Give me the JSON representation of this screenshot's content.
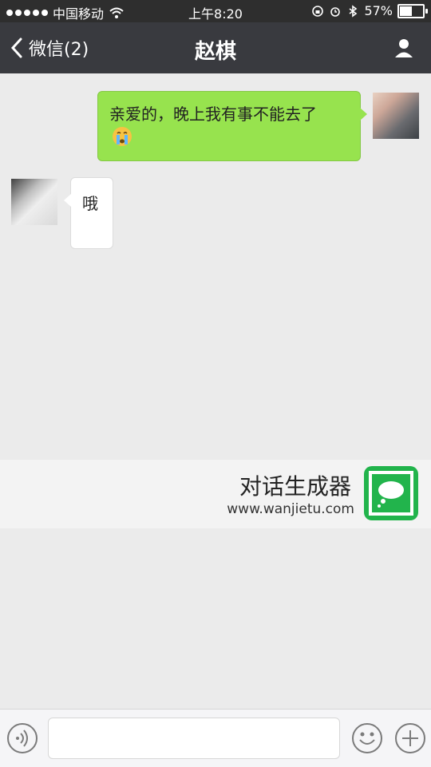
{
  "status_bar": {
    "carrier": "中国移动",
    "time": "上午8:20",
    "battery": "57%",
    "battery_level": 0.57
  },
  "nav": {
    "back_label": "微信(2)",
    "title": "赵棋"
  },
  "messages": [
    {
      "sender": "me",
      "text": "亲爱的，晚上我有事不能去了"
    },
    {
      "sender": "other",
      "text": "哦"
    }
  ],
  "banner": {
    "title": "对话生成器",
    "url": "www.wanjietu.com"
  },
  "input": {
    "placeholder": ""
  },
  "colors": {
    "nav_bg": "#393a3f",
    "status_bg": "#2e2e2e",
    "bubble_me": "#97e34e",
    "bubble_other": "#ffffff",
    "logo_green": "#22b44c"
  },
  "icons": {
    "back": "chevron-left-icon",
    "profile": "person-icon",
    "voice": "voice-icon",
    "emoji": "smiley-icon",
    "plus": "plus-icon"
  }
}
